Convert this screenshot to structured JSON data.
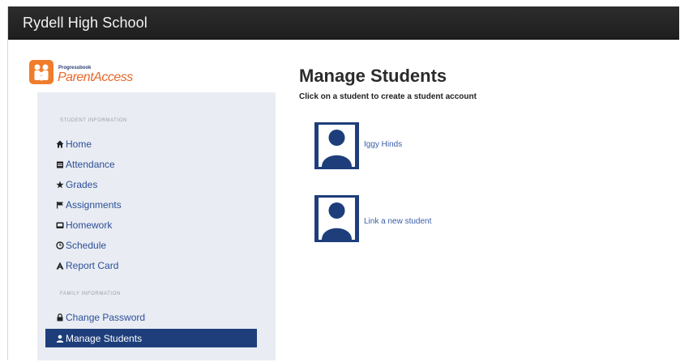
{
  "header": {
    "school_name": "Rydell High School"
  },
  "logo": {
    "small_text": "Progressbook",
    "big_text": "ParentAccess"
  },
  "sidebar": {
    "student_section_label": "STUDENT INFORMATION",
    "student_items": [
      {
        "label": "Home",
        "icon": "home-icon"
      },
      {
        "label": "Attendance",
        "icon": "calendar-icon"
      },
      {
        "label": "Grades",
        "icon": "star-icon"
      },
      {
        "label": "Assignments",
        "icon": "flag-icon"
      },
      {
        "label": "Homework",
        "icon": "book-icon"
      },
      {
        "label": "Schedule",
        "icon": "clock-icon"
      },
      {
        "label": "Report Card",
        "icon": "report-card-icon"
      }
    ],
    "family_section_label": "FAMILY INFORMATION",
    "family_items": [
      {
        "label": "Change Password",
        "icon": "lock-icon"
      },
      {
        "label": "Manage Students",
        "icon": "user-icon",
        "active": true
      }
    ]
  },
  "main": {
    "title": "Manage Students",
    "subtitle": "Click on a student to create a student account",
    "students": [
      {
        "label": "Iggy Hinds"
      },
      {
        "label": "Link a new student"
      }
    ]
  },
  "colors": {
    "topbar": "#222222",
    "sidebar_bg": "#e9ecf2",
    "active_item": "#1e3e7b",
    "link": "#2c4f9a",
    "logo_orange": "#ef7d2c"
  }
}
